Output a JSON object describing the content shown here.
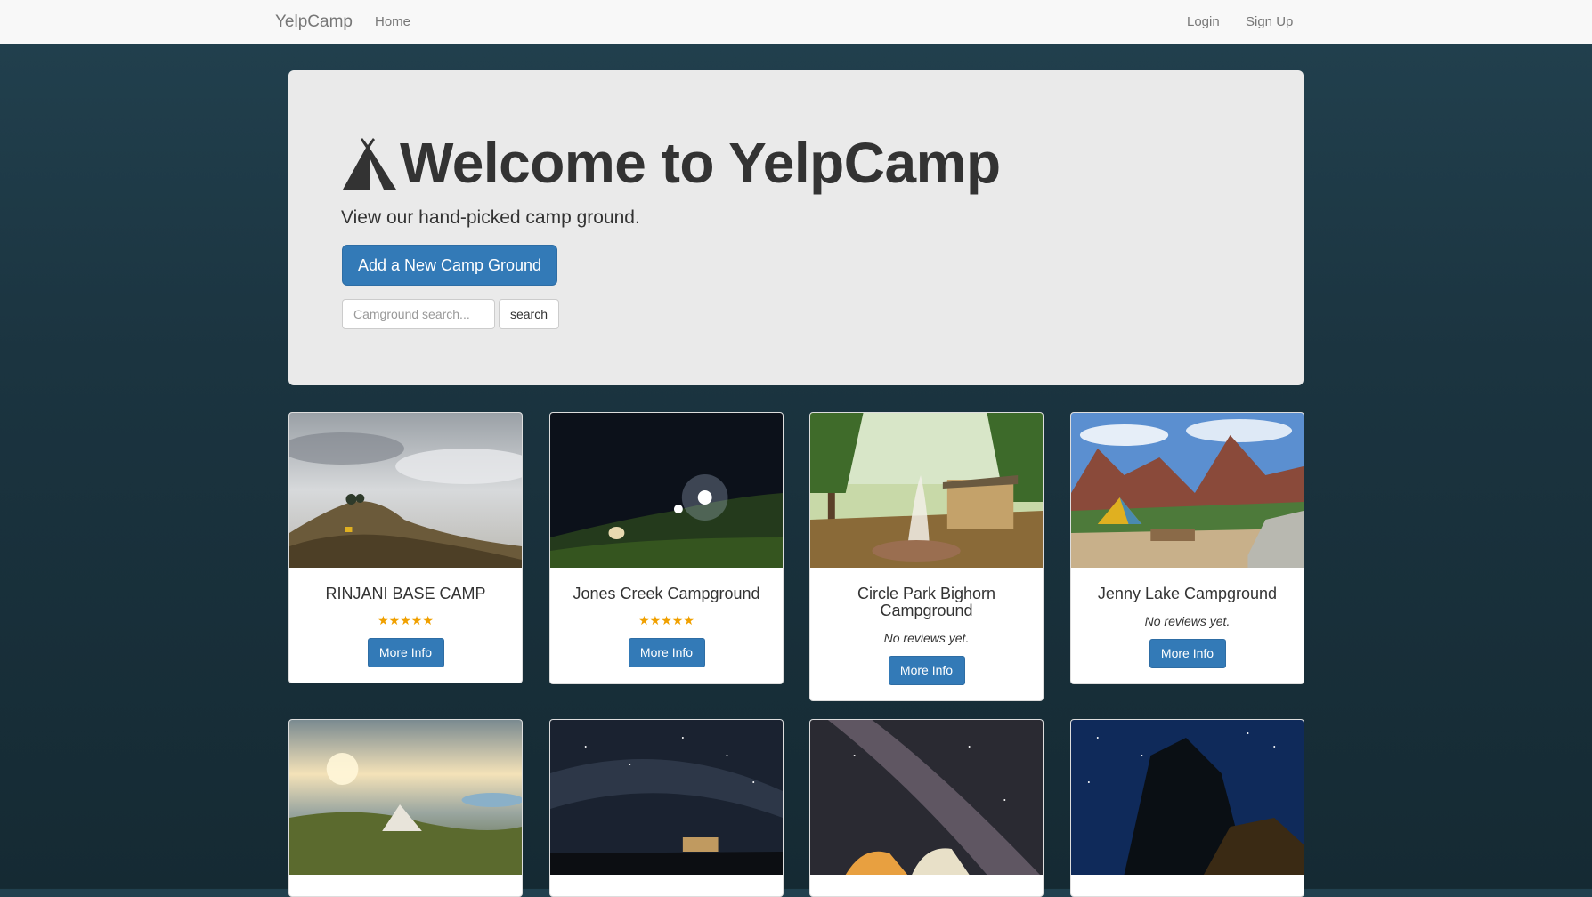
{
  "nav": {
    "brand": "YelpCamp",
    "home": "Home",
    "login": "Login",
    "signup": "Sign Up"
  },
  "hero": {
    "title": "Welcome to YelpCamp",
    "subtitle": "View our hand-picked camp ground.",
    "add_button": "Add a New Camp Ground",
    "search_placeholder": "Camground search...",
    "search_button": "search"
  },
  "campgrounds": [
    {
      "name": "RINJANI BASE CAMP",
      "rating": 5,
      "stars": "★★★★★",
      "reviews_text": "",
      "button": "More Info"
    },
    {
      "name": "Jones Creek Campground",
      "rating": 5,
      "stars": "★★★★★",
      "reviews_text": "",
      "button": "More Info"
    },
    {
      "name": "Circle Park Bighorn Campground",
      "rating": null,
      "stars": "",
      "reviews_text": "No reviews yet.",
      "button": "More Info"
    },
    {
      "name": "Jenny Lake Campground",
      "rating": null,
      "stars": "",
      "reviews_text": "No reviews yet.",
      "button": "More Info"
    }
  ],
  "colors": {
    "primary": "#337ab7",
    "star": "#f0a000",
    "background": "#1b3440"
  },
  "icons": {
    "hero": "tent-icon"
  }
}
